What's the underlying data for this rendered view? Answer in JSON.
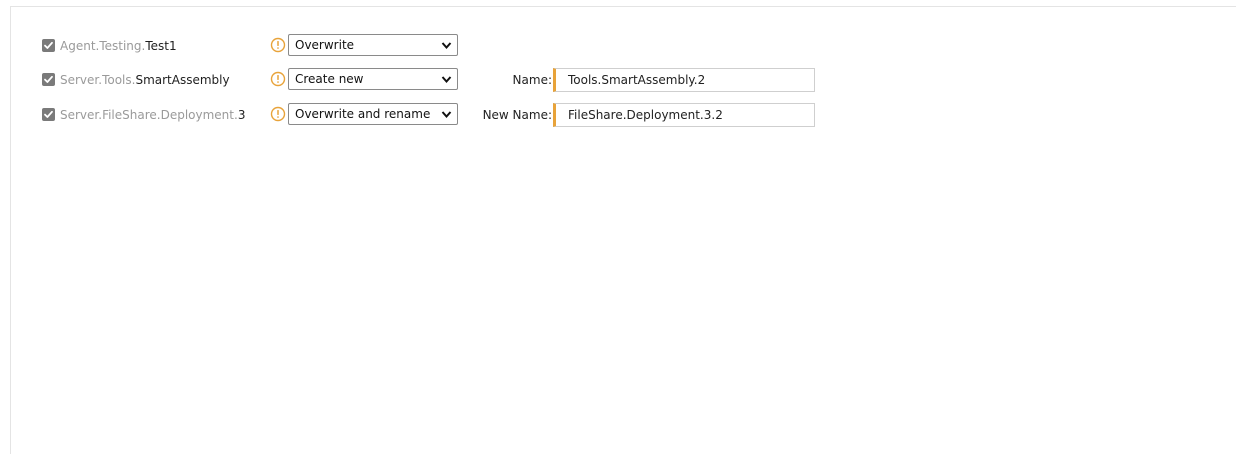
{
  "colors": {
    "warning": "#e8a33a",
    "checkbox": "#7a7a7a",
    "prefix_text": "#9a9a9a"
  },
  "rows": [
    {
      "checked": true,
      "prefix": "Agent.Testing.",
      "leaf": "Test1",
      "action": "Overwrite",
      "field_label": "",
      "field_value": ""
    },
    {
      "checked": true,
      "prefix": "Server.Tools.",
      "leaf": "SmartAssembly",
      "action": "Create new",
      "field_label": "Name:",
      "field_value": "Tools.SmartAssembly.2"
    },
    {
      "checked": true,
      "prefix": "Server.FileShare.Deployment.",
      "leaf": "3",
      "action": "Overwrite and rename",
      "field_label": "New Name:",
      "field_value": "FileShare.Deployment.3.2"
    }
  ],
  "icons": {
    "checkbox": "check-icon",
    "warning": "warning-circle-icon",
    "dropdown": "chevron-down-icon"
  }
}
